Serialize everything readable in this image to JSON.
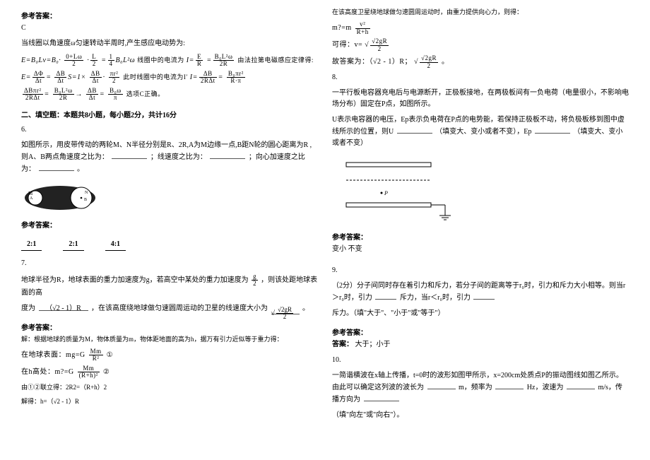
{
  "left": {
    "ref_answer_label": "参考答案：",
    "q5_ans": "C",
    "q5_body": "当线圈以角速度ω匀速转动半周时,产生感应电动势为:",
    "q5_line2a": "E=B₀Lv=B₀",
    "q5_mid1": "线圈中的电流为",
    "q5_mid2": "由法拉第电磁感应定律得:",
    "q5_mid3": "此时线圈中的电流为I′",
    "q5_conclusion": "选项C正确。",
    "section2_title": "二、填空题：本题共8小题，每小题2分，共计16分",
    "q6_num": "6.",
    "q6_body": "如图所示，用皮带传动的两轮M、N半径分别是R、2R,A为M边缘一点,B距N轮的圆心距离为R ,则A、B两点角速度之比为：",
    "q6_blank2_pre": "；线速度之比为：",
    "q6_blank3_pre": "；向心加速度之比为：",
    "q6_end": "。",
    "q6_ans1": "2:1",
    "q6_ans2": "2:1",
    "q6_ans3": "4:1",
    "q7_num": "7.",
    "q7_body_a": "地球半径为R，地球表面的重力加速度为g，若高空中某处的重力加速度为",
    "q7_body_b": "，则该处距地球表面的高",
    "q7_body_c": "度为",
    "q7_body_d": "，在该高度绕地球做匀速圆周运动的卫星的线速度大小为",
    "q7_body_e": "。",
    "q7_ans_blank1": "（√2 - 1）R",
    "q7_sol_l1": "解：根据地球的质量为M，物体质量为m，物体距地面的高为h，据万有引力近似等于重力得：",
    "q7_sol_l2": "在地球表面：mg=G",
    "q7_sol_l2b": " ①",
    "q7_sol_l3": "在h高处：m?=G",
    "q7_sol_l3b": " ②",
    "q7_sol_l4": "由①②联立得：2R2=（R+h）2",
    "q7_sol_l5": "解得：h=（√2 - 1）R",
    "frac_g2_num": "g",
    "frac_g2_den": "2",
    "frac_v_num": "√2gR",
    "frac_v_den": "2",
    "frac_MR2_num": "Mm",
    "frac_MR2_den": "R²",
    "frac_MRh_num": "Mm",
    "frac_MRh_den": "(R+h)²",
    "frac_halfg": "g/2"
  },
  "right": {
    "q7r_l1": "在该高度卫星绕地球做匀速圆周运动时，由重力提供向心力，则得：",
    "q7r_l2": "m?=m",
    "q7r_l3": "可得：v=",
    "q7r_l4": "故答案为：（√2 - 1）R；",
    "q7r_l4b": "。",
    "frac_v2Rh_num": "v²",
    "frac_v2Rh_den": "R+h",
    "frac_sqrt2gR2_num": "√2gR",
    "frac_sqrt2gR2_den": "2",
    "q8_num": "8.",
    "q8_body_a": "一平行板电容器充电后与电源断开，正极板接地，在两极板间有一负电荷（电量很小，不影响电场分布）固定在P点，如图所示。",
    "q8_body_b": "U表示电容器的电压，Ep表示负电荷在P点的电势能，若保持正极板不动，将负极板移到图中虚线所示的位置，则U",
    "q8_body_b2": "（填变大、变小或者不变），Ep",
    "q8_body_b3": "（填变大、变小或者不变）",
    "ref_answer_label": "参考答案：",
    "q8_ans": "变小   不变",
    "q9_num": "9.",
    "q9_body_a": "（2分）分子间同时存在着引力和斥力，若分子间的距离等于r₀时，引力和斥力大小相等。则当r＞r₀时，引力",
    "q9_body_a2": "斥力，当r＜r₀时，引力",
    "q9_body_b": "斥力。（填\"大于\"、\"小于\"或\"等于\"）",
    "q9_ans_label": "答案：",
    "q9_ans": "大于；小于",
    "q10_num": "10.",
    "q10_body_a": "一简谐横波在x轴上传播，t=0时的波形如图甲所示，x=200cm处质点P的振动图线如图乙所示。由此可以确定这列波的波长为",
    "q10_body_a2": "m，频率为",
    "q10_body_a3": "Hz，波速为",
    "q10_body_a4": "m/s，传播方向为",
    "q10_body_b": "（填\"向左\"或\"向右\"）。"
  }
}
